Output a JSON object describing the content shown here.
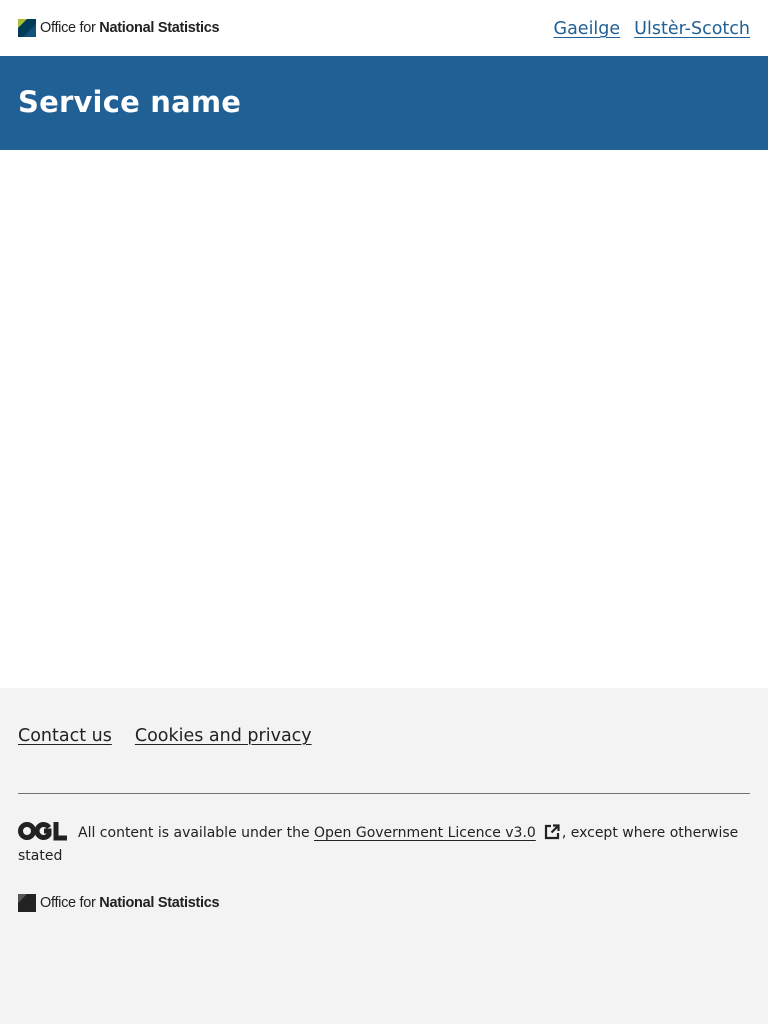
{
  "header": {
    "logo": {
      "text_regular": "Office for ",
      "text_bold": "National Statistics",
      "icon": "ons-logo-icon"
    },
    "language_links": [
      {
        "label": "Gaeilge"
      },
      {
        "label": "Ulstèr-Scotch"
      }
    ]
  },
  "service_bar": {
    "service_name": "Service name"
  },
  "footer": {
    "links": [
      {
        "label": "Contact us"
      },
      {
        "label": "Cookies and privacy"
      }
    ],
    "licence": {
      "icon": "ogl-logo-icon",
      "prefix": "All content is available under the",
      "link_label": "Open Government Licence v3.0",
      "external_icon": "external-link-icon",
      "suffix": ", except where otherwise stated"
    },
    "logo": {
      "text_regular": "Office for ",
      "text_bold": "National Statistics",
      "icon": "ons-logo-icon"
    }
  },
  "colors": {
    "brand_blue": "#206095",
    "ons_teal": "#003c57",
    "ons_green": "#a8bd3a",
    "footer_background": "#f3f3f3"
  }
}
